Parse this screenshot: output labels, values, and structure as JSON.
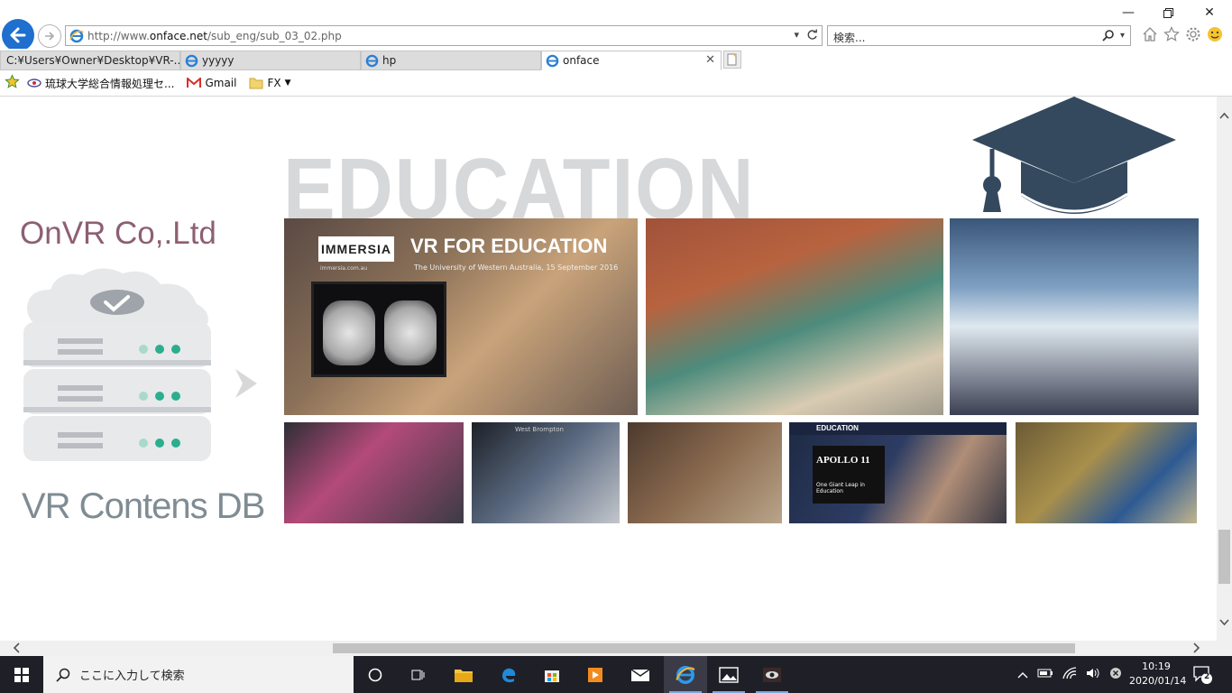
{
  "browser": {
    "url_prefix": "http://www.",
    "url_domain": "onface.net",
    "url_path": "/sub_eng/sub_03_02.php",
    "search_placeholder": "検索...",
    "tabs": [
      {
        "label": "C:¥Users¥Owner¥Desktop¥VR-...",
        "active": false
      },
      {
        "label": "yyyyy",
        "active": false
      },
      {
        "label": "hp",
        "active": false
      },
      {
        "label": "onface",
        "active": true
      }
    ],
    "favorites": [
      {
        "label": "琉球大学総合情報処理セ..."
      },
      {
        "label": "Gmail"
      },
      {
        "label": "FX"
      }
    ]
  },
  "page": {
    "heading": "EDUCATION",
    "brand": "OnVR Co,.Ltd",
    "brand_sub": "VR Contens DB",
    "photo1": {
      "logo": "IMMERSIA",
      "title": "VR FOR EDUCATION",
      "subtitle": "The University of Western Australia, 15 September 2016",
      "site": "immersia.com.au"
    },
    "photo5": {
      "label": "West Brompton"
    },
    "photo7": {
      "header": "EDUCATION",
      "poster_title": "APOLLO 11",
      "poster_sub": "One Giant Leap in Education"
    }
  },
  "taskbar": {
    "search_placeholder": "ここに入力して検索",
    "time": "10:19",
    "date": "2020/01/14",
    "notifications": "2"
  },
  "colors": {
    "accent_blue": "#1e6fce",
    "brand_purple": "#8d5f73",
    "brand_grey": "#7f8c93",
    "cap_navy": "#34495e",
    "taskbar": "#1f1f27"
  },
  "icons": [
    "back-arrow-icon",
    "forward-arrow-icon",
    "ie-icon",
    "refresh-icon",
    "search-icon",
    "home-icon",
    "star-icon",
    "gear-icon",
    "smiley-icon",
    "gmail-icon",
    "folder-icon",
    "windows-icon",
    "cortana-icon",
    "task-view-icon",
    "file-explorer-icon",
    "edge-icon",
    "store-icon",
    "media-icon",
    "mail-icon",
    "photos-icon",
    "eye-app-icon",
    "battery-icon",
    "wifi-icon",
    "volume-icon",
    "notification-icon",
    "graduation-cap-icon",
    "cloud-database-icon",
    "chevron-right-icon"
  ]
}
